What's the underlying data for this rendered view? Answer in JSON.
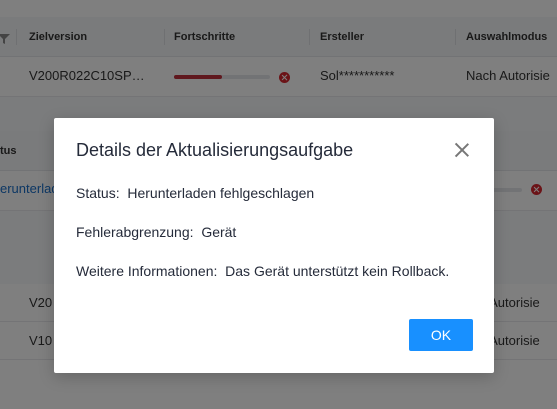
{
  "top_table": {
    "headers": {
      "target_version": "Zielversion",
      "progress": "Fortschritte",
      "creator": "Ersteller",
      "selection_mode": "Auswahlmodus"
    },
    "row": {
      "target_version": "V200R022C10SP…",
      "progress_fraction": 0.5,
      "creator": "Sol***********",
      "selection_mode": "Nach Autorisie"
    }
  },
  "middle_table": {
    "header_partial": "tus",
    "row_status_partial": "erunterlad"
  },
  "bottom_table": {
    "rows": [
      {
        "version_partial": "V20",
        "mode_partial": "h Autorisie"
      },
      {
        "version_partial": "V10",
        "mode_partial": "h Autorisie"
      }
    ]
  },
  "dialog": {
    "title": "Details der Aktualisierungsaufgabe",
    "status_label": "Status",
    "status_value": "Herunterladen fehlgeschlagen",
    "fault_label": "Fehlerabgrenzung",
    "fault_value": "Gerät",
    "more_label": "Weitere Informationen",
    "more_value": "Das Gerät unterstützt kein Rollback.",
    "ok_label": "OK"
  },
  "colors": {
    "accent": "#1890ff",
    "error": "#d7262f",
    "progress_fill": "#c0303c"
  }
}
